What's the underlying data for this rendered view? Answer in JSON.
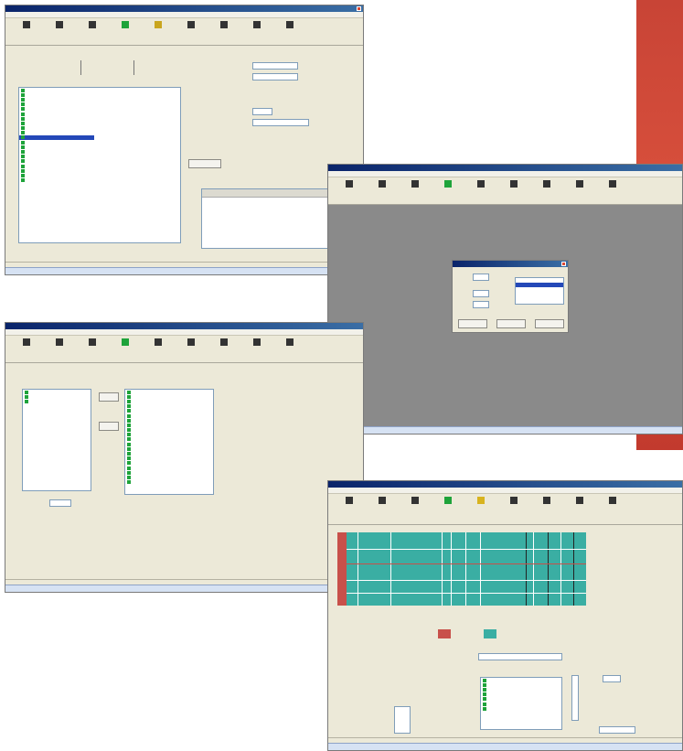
{
  "background": {
    "accent": "#c84436"
  },
  "windows": {
    "w1": {
      "title": ""
    },
    "w2": {
      "title": ""
    },
    "w3": {
      "title": ""
    },
    "w4": {
      "title": ""
    }
  },
  "colors": {
    "grid_teal": "#3aaea3",
    "grid_red": "#c8504a",
    "selection": "#2448b8",
    "status_green": "#1ea33a"
  },
  "icons": [
    "lock-icon",
    "save-icon",
    "list-icon",
    "grid-icon",
    "chart-icon",
    "arrow-icon",
    "pen-icon",
    "dot-icon",
    "pointer-icon"
  ]
}
